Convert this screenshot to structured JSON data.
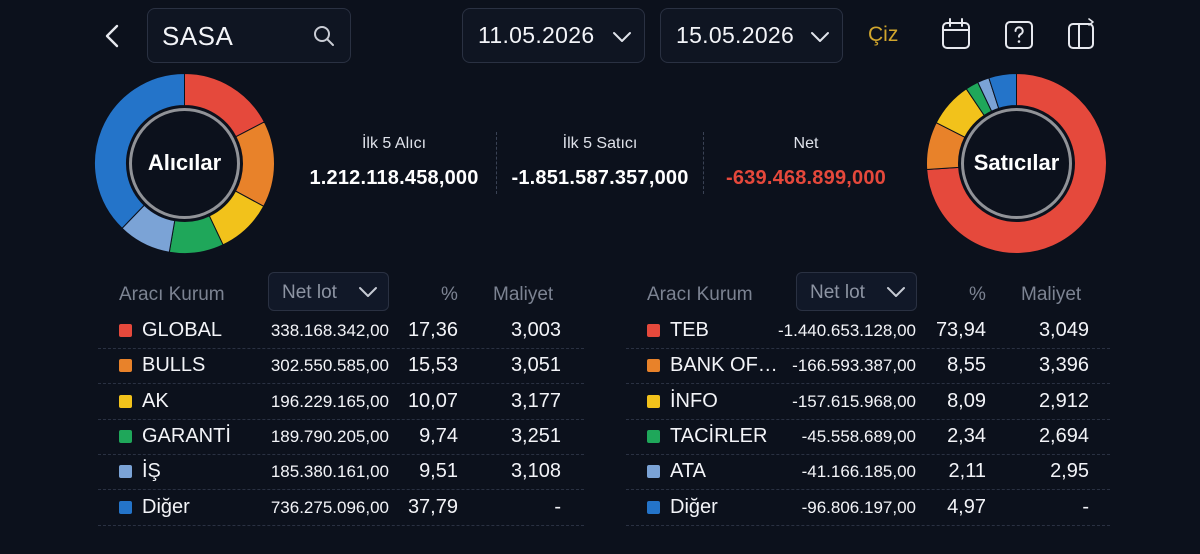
{
  "search": {
    "value": "SASA"
  },
  "dates": {
    "start": "11.05.2026",
    "end": "15.05.2026"
  },
  "draw_button": "Çiz",
  "icons": [
    "back-icon",
    "search-icon",
    "chevron-down-icon",
    "calendar-icon",
    "help-icon",
    "layout-switch-icon"
  ],
  "colors": {
    "red": "#e5493c",
    "orange": "#e8822a",
    "yellow": "#f2c21b",
    "green": "#1fa75a",
    "lightblue": "#7ba3d6",
    "blue": "#2474c9",
    "negative": "#e5483b",
    "accent": "#d1a62d"
  },
  "buyers": {
    "donut_label": "Alıcılar",
    "total_label": "İlk 5 Alıcı",
    "total_value": "1.212.118.458,000",
    "headers": {
      "broker": "Aracı Kurum",
      "netlot": "Net lot",
      "pct": "%",
      "cost": "Maliyet"
    },
    "rows": [
      {
        "name": "GLOBAL",
        "lot": "338.168.342,00",
        "pct": "17,36",
        "cost": "3,003",
        "color": "#e5493c",
        "share": 17.36
      },
      {
        "name": "BULLS",
        "lot": "302.550.585,00",
        "pct": "15,53",
        "cost": "3,051",
        "color": "#e8822a",
        "share": 15.53
      },
      {
        "name": "AK",
        "lot": "196.229.165,00",
        "pct": "10,07",
        "cost": "3,177",
        "color": "#f2c21b",
        "share": 10.07
      },
      {
        "name": "GARANTİ",
        "lot": "189.790.205,00",
        "pct": "9,74",
        "cost": "3,251",
        "color": "#1fa75a",
        "share": 9.74
      },
      {
        "name": "İŞ",
        "lot": "185.380.161,00",
        "pct": "9,51",
        "cost": "3,108",
        "color": "#7ba3d6",
        "share": 9.51
      },
      {
        "name": "Diğer",
        "lot": "736.275.096,00",
        "pct": "37,79",
        "cost": "-",
        "color": "#2474c9",
        "share": 37.79
      }
    ]
  },
  "sellers": {
    "donut_label": "Satıcılar",
    "total_label": "İlk 5 Satıcı",
    "total_value": "-1.851.587.357,000",
    "headers": {
      "broker": "Aracı Kurum",
      "netlot": "Net lot",
      "pct": "%",
      "cost": "Maliyet"
    },
    "rows": [
      {
        "name": "TEB",
        "lot": "-1.440.653.128,00",
        "pct": "73,94",
        "cost": "3,049",
        "color": "#e5493c",
        "share": 73.94
      },
      {
        "name": "BANK OF…",
        "lot": "-166.593.387,00",
        "pct": "8,55",
        "cost": "3,396",
        "color": "#e8822a",
        "share": 8.55
      },
      {
        "name": "İNFO",
        "lot": "-157.615.968,00",
        "pct": "8,09",
        "cost": "2,912",
        "color": "#f2c21b",
        "share": 8.09
      },
      {
        "name": "TACİRLER",
        "lot": "-45.558.689,00",
        "pct": "2,34",
        "cost": "2,694",
        "color": "#1fa75a",
        "share": 2.34
      },
      {
        "name": "ATA",
        "lot": "-41.166.185,00",
        "pct": "2,11",
        "cost": "2,95",
        "color": "#7ba3d6",
        "share": 2.11
      },
      {
        "name": "Diğer",
        "lot": "-96.806.197,00",
        "pct": "4,97",
        "cost": "-",
        "color": "#2474c9",
        "share": 4.97
      }
    ]
  },
  "net": {
    "label": "Net",
    "value": "-639.468.899,000"
  }
}
